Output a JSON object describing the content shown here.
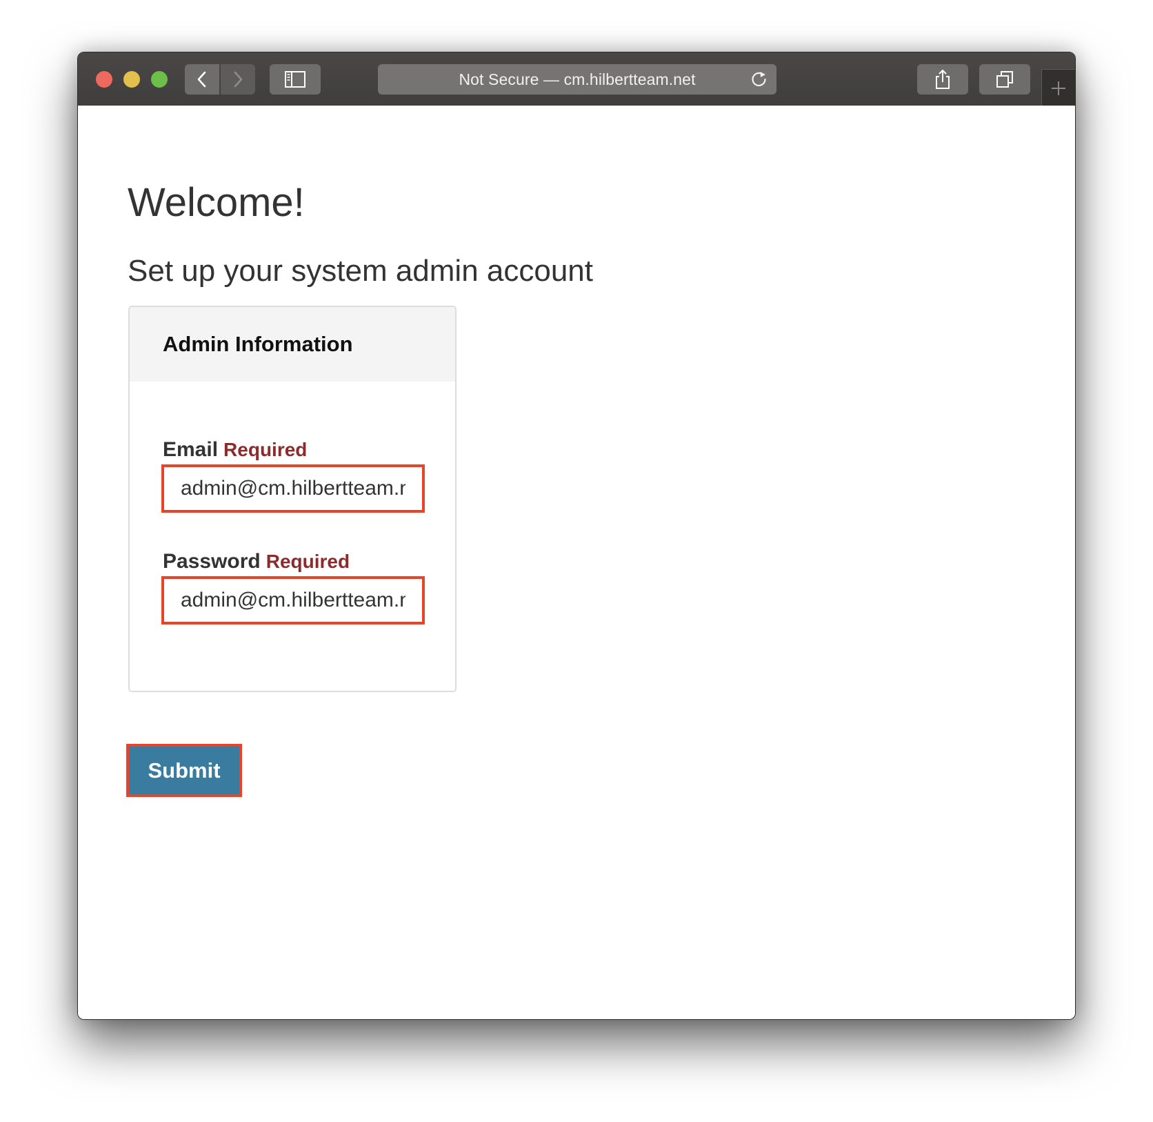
{
  "browser": {
    "address_text": "Not Secure — cm.hilbertteam.net",
    "icons": {
      "close": "traffic-light-red",
      "minimize": "traffic-light-yellow",
      "zoom": "traffic-light-green",
      "back": "chevron-left-icon",
      "forward": "chevron-right-icon",
      "sidebar": "sidebar-icon",
      "reload": "reload-icon",
      "share": "share-icon",
      "tabs": "tabs-overview-icon",
      "new_tab": "plus-icon"
    }
  },
  "page": {
    "heading": "Welcome!",
    "subheading": "Set up your system admin account",
    "card": {
      "title": "Admin Information",
      "email": {
        "label": "Email",
        "required": "Required",
        "value": "admin@cm.hilbertteam.net"
      },
      "password": {
        "label": "Password",
        "required": "Required",
        "value": "admin@cm.hilbertteam.net"
      }
    },
    "submit_label": "Submit"
  },
  "colors": {
    "highlight_border": "#ea4327",
    "submit_bg": "#3a7ba0",
    "required_text": "#8b2b2b",
    "toolbar_bg": "#434140"
  }
}
